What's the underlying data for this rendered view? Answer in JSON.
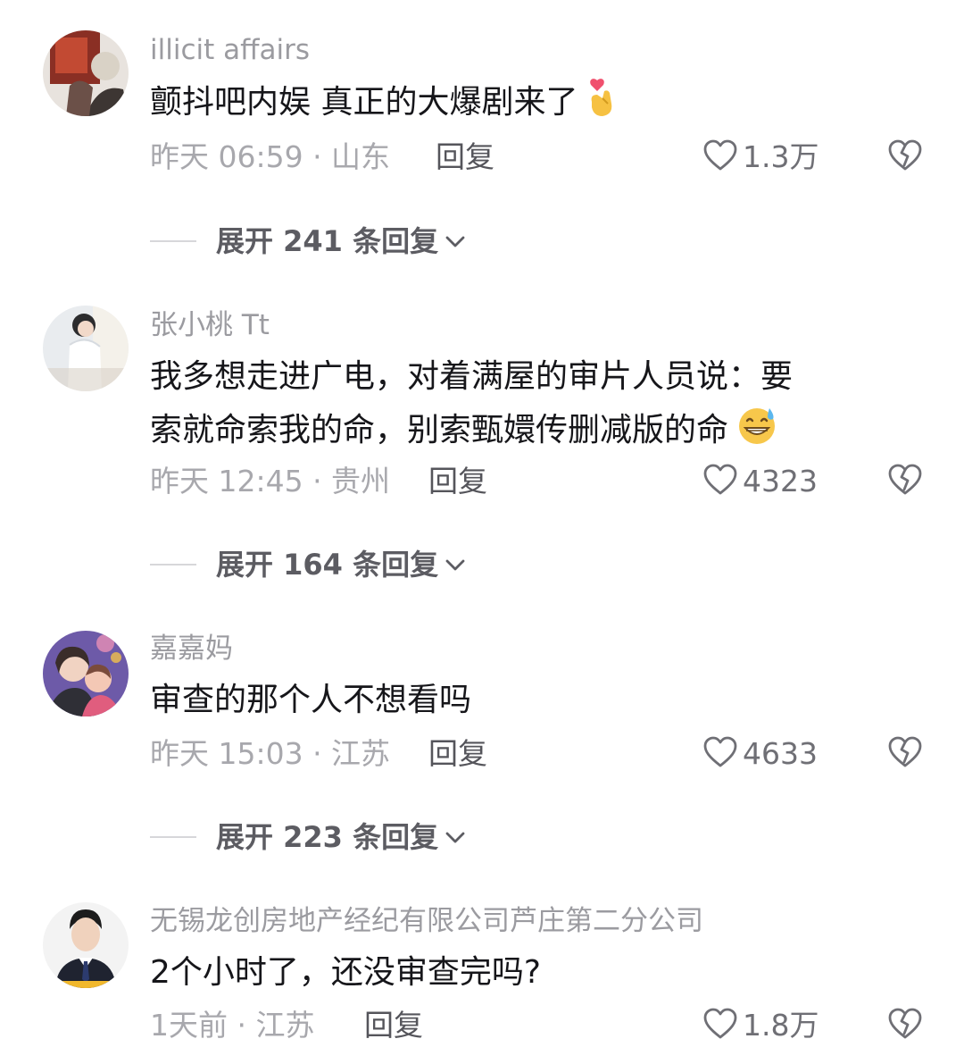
{
  "comments": [
    {
      "username": "illicit affairs",
      "content": "颤抖吧内娱 真正的大爆剧来了",
      "emoji": "finger-heart-emoji",
      "meta": "昨天 06:59 · 山东",
      "reply_label": "回复",
      "likes": "1.3万",
      "expand_label": "展开 241 条回复",
      "avatar": "avatar-photo-dark-red"
    },
    {
      "username": "张小桃 Tt",
      "content_lines": [
        "我多想走进广电，对着满屋的审片人员说：要",
        "索就命索我的命，别索甄嬛传删减版的命"
      ],
      "emoji": "grinning-sweat-emoji",
      "meta": "昨天 12:45 · 贵州",
      "reply_label": "回复",
      "likes": "4323",
      "expand_label": "展开 164 条回复",
      "avatar": "avatar-photo-light"
    },
    {
      "username": "嘉嘉妈",
      "content": "审查的那个人不想看吗",
      "meta": "昨天 15:03 · 江苏",
      "reply_label": "回复",
      "likes": "4633",
      "expand_label": "展开 223 条回复",
      "avatar": "avatar-photo-family"
    },
    {
      "username": "无锡龙创房地产经纪有限公司芦庄第二分公司",
      "content": "2个小时了，还没审查完吗?",
      "meta": "1天前 · 江苏",
      "reply_label": "回复",
      "likes": "1.8万",
      "avatar": "avatar-photo-man-suit"
    }
  ],
  "colors": {
    "username": "#9b9ba0",
    "content": "#16161a",
    "meta": "#a8a8ad",
    "reply": "#55555b",
    "expand": "#5c5c62",
    "icon": "#6f6f75"
  },
  "icons": {
    "like": "heart-outline-icon",
    "dislike": "broken-heart-icon",
    "expand": "chevron-down-icon"
  }
}
